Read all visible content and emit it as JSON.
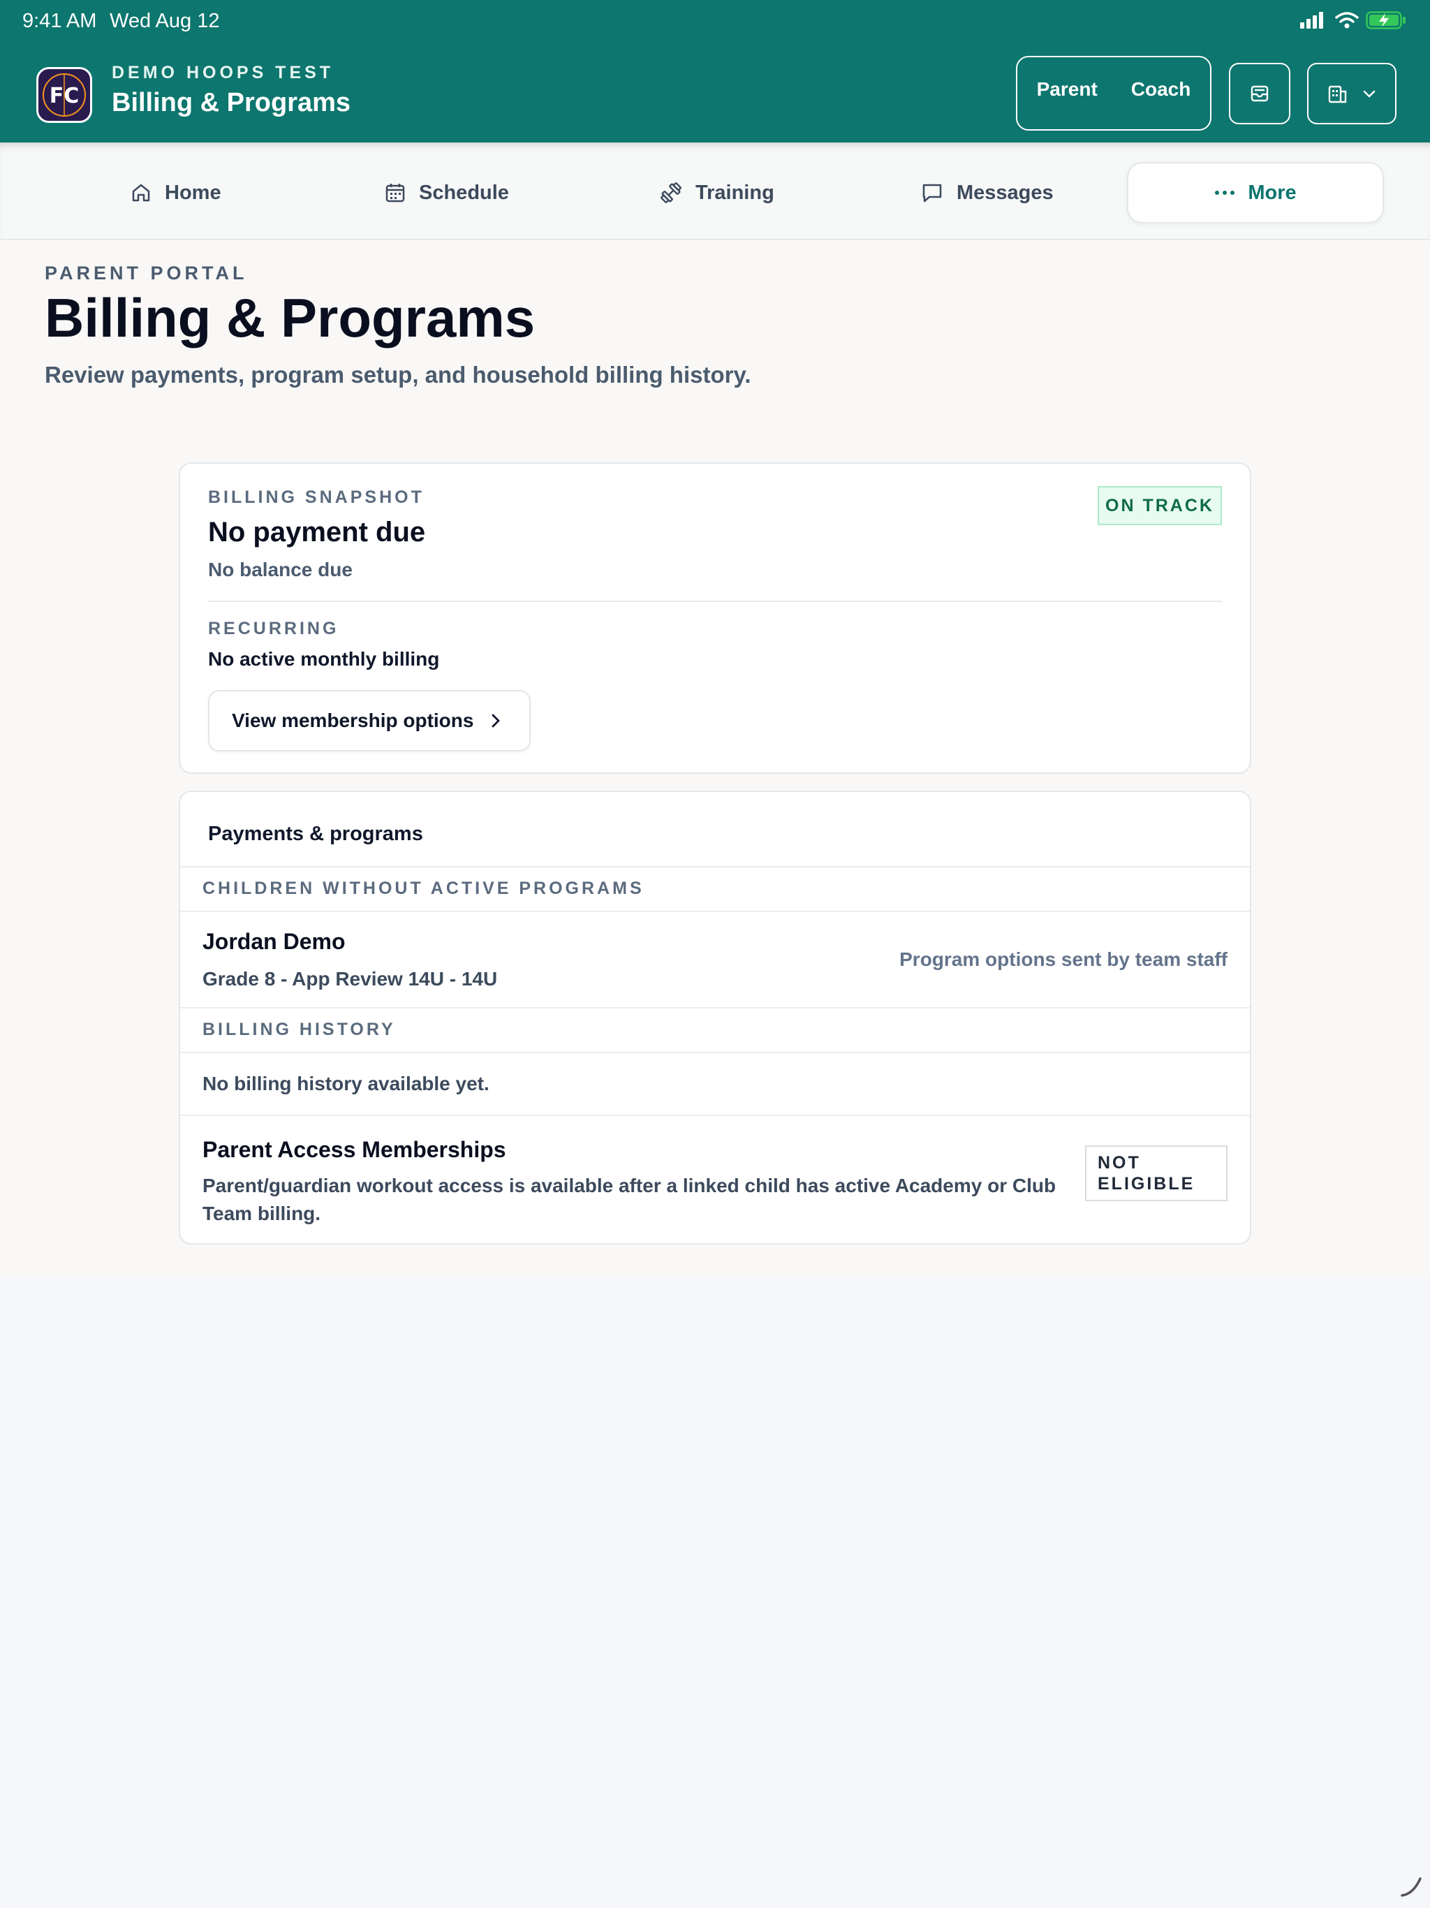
{
  "status_bar": {
    "time": "9:41 AM",
    "date": "Wed Aug 12"
  },
  "header": {
    "logo_text": "FC",
    "org_name": "DEMO HOOPS TEST",
    "title": "Billing & Programs",
    "roles": [
      "Parent",
      "Coach"
    ]
  },
  "nav": {
    "items": [
      {
        "label": "Home",
        "icon": "home-icon"
      },
      {
        "label": "Schedule",
        "icon": "calendar-icon"
      },
      {
        "label": "Training",
        "icon": "dumbbell-icon"
      },
      {
        "label": "Messages",
        "icon": "message-icon"
      },
      {
        "label": "More",
        "icon": "more-icon",
        "active": true
      }
    ]
  },
  "page": {
    "eyebrow": "PARENT PORTAL",
    "title": "Billing & Programs",
    "subtitle": "Review payments, program setup, and household billing history."
  },
  "snapshot": {
    "label": "BILLING SNAPSHOT",
    "status": "ON TRACK",
    "heading": "No payment due",
    "balance": "No balance due",
    "recurring_label": "RECURRING",
    "recurring_value": "No active monthly billing",
    "membership_button": "View membership options"
  },
  "payments": {
    "title": "Payments & programs",
    "children_label": "CHILDREN WITHOUT ACTIVE PROGRAMS",
    "child_name": "Jordan Demo",
    "child_detail": "Grade 8 - App Review 14U - 14U",
    "child_note": "Program options sent by team staff",
    "history_label": "BILLING HISTORY",
    "history_empty": "No billing history available yet.",
    "memberships_title": "Parent Access Memberships",
    "memberships_desc": "Parent/guardian workout access is available after a linked child has active Academy or Club Team billing.",
    "memberships_status": "NOT ELIGIBLE"
  },
  "colors": {
    "brand": "#0d766e",
    "on_track_bg": "#e8fbf1",
    "on_track_text": "#0f6b48",
    "battery": "#34c759"
  }
}
